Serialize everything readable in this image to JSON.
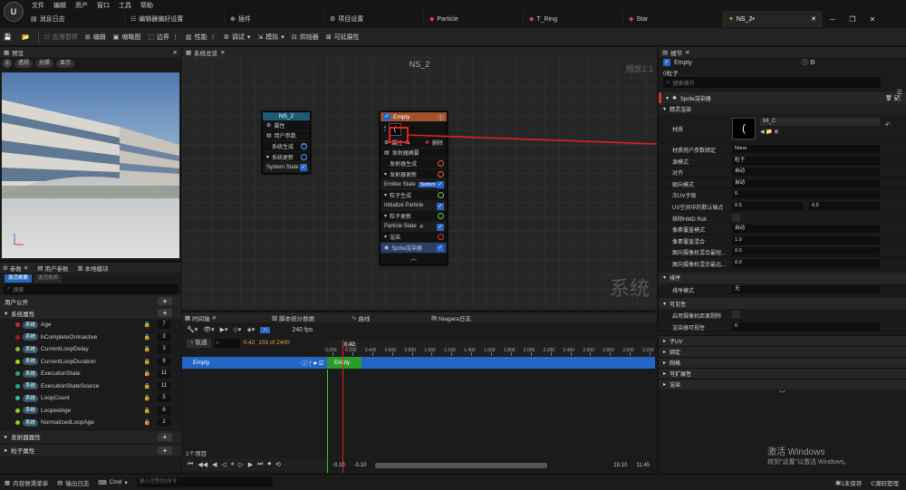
{
  "menubar": {
    "items": [
      "文件",
      "编辑",
      "资产",
      "窗口",
      "工具",
      "帮助"
    ]
  },
  "tabs": [
    {
      "label": "消息日志",
      "icon": "message-log-icon",
      "active": false
    },
    {
      "label": "编辑器偏好设置",
      "icon": "preferences-icon",
      "active": false
    },
    {
      "label": "插件",
      "icon": "plugin-icon",
      "active": false
    },
    {
      "label": "项目设置",
      "icon": "settings-icon",
      "active": false
    },
    {
      "label": "Particle",
      "icon": "particle-icon",
      "active": false
    },
    {
      "label": "T_Ring",
      "icon": "texture-icon",
      "active": false
    },
    {
      "label": "Star",
      "icon": "texture-icon",
      "active": false
    },
    {
      "label": "NS_2•",
      "icon": "niagara-icon",
      "active": true
    }
  ],
  "toolbar": {
    "apply_label": "应用暂停",
    "compile_label": "编辑",
    "thumbnail_label": "缩略图",
    "bounds_label": "边界",
    "perf_label": "性能",
    "debug_label": "调试",
    "simulate_label": "模拟",
    "baker_label": "烘焙器",
    "scalability_label": "可延展性"
  },
  "preview": {
    "tab_label": "预览",
    "perspective_label": "透视",
    "lighting_label": "光照",
    "show_label": "显示"
  },
  "params": {
    "tabs": [
      "参数",
      "用户参数",
      "本地模块"
    ],
    "subtabs": [
      "激活概要",
      "激活视频"
    ],
    "search_placeholder": "搜索",
    "sections": {
      "user": "用户公开",
      "system": "系统属性",
      "emitter": "发射器属性",
      "particle": "粒子属性"
    },
    "rows": [
      {
        "badge": "系统",
        "name": "Age",
        "value": "7",
        "color": "#c52b2b"
      },
      {
        "badge": "系统",
        "name": "bCompleteOnInactive",
        "value": "3",
        "color": "#a11a1a"
      },
      {
        "badge": "系统",
        "name": "CurrentLoopDelay",
        "value": "3",
        "color": "#7dc41c"
      },
      {
        "badge": "系统",
        "name": "CurrentLoopDuration",
        "value": "9",
        "color": "#9fd21a"
      },
      {
        "badge": "系统",
        "name": "ExecutionState",
        "value": "11",
        "color": "#2aa38c"
      },
      {
        "badge": "系统",
        "name": "ExecutionStateSource",
        "value": "11",
        "color": "#2aa38c"
      },
      {
        "badge": "系统",
        "name": "LoopCount",
        "value": "5",
        "color": "#2fbf94"
      },
      {
        "badge": "系统",
        "name": "LoopedAge",
        "value": "6",
        "color": "#83d21c"
      },
      {
        "badge": "系统",
        "name": "NormalizedLoopAge",
        "value": "2",
        "color": "#83d21c"
      }
    ]
  },
  "graph": {
    "tab_label": "系统总览",
    "title": "NS_2",
    "zoom": "缩放1:1",
    "watermark": "系统",
    "system_node": {
      "title": "NS_2",
      "rows": [
        "属性",
        "用户参数",
        "系统生成",
        "系统更新",
        "System State"
      ]
    },
    "emitter_node": {
      "title": "Empty",
      "sprite": "(",
      "rows": [
        "属性",
        "删除",
        "发射器摘要",
        "发射器生成",
        "发射器更新",
        "Emitter State",
        "System",
        "粒子生成",
        "Initialize Particle",
        "粒子更新",
        "Particle State",
        "渲染",
        "Sprite渲染器"
      ]
    }
  },
  "timeline": {
    "tabs": [
      "时间轴",
      "脚本统计数据",
      "曲线",
      "Niagara日志"
    ],
    "fps": "240 fps",
    "add_track": "轨道",
    "current": "0.42",
    "frames": "103 of 2400",
    "track": "Empty",
    "clip": "Empty",
    "playhead": "0.42",
    "ticks": [
      "0.000",
      "0.200",
      "0.400",
      "0.600",
      "0.800",
      "1.000",
      "1.200",
      "1.400",
      "1.600",
      "1.800",
      "2.000",
      "2.200",
      "2.400",
      "2.600",
      "2.800",
      "3.000",
      "3.200"
    ],
    "count_label": "1个项目",
    "range": [
      "-0.10",
      "-0.10",
      "10.10",
      "11.45"
    ]
  },
  "details": {
    "tab_label": "细节",
    "name": "Empty",
    "particles": "0粒子",
    "search_placeholder": "搜索细节",
    "renderer_label": "Sprite渲染器",
    "binding_section": "精灵渲染",
    "material_label": "材质",
    "material_value": "MI_C",
    "rows": [
      {
        "label": "材质用户参数绑定",
        "value": "None"
      },
      {
        "label": "源模式",
        "value": "粒子"
      },
      {
        "label": "对齐",
        "value": "自动"
      },
      {
        "label": "朝向模式",
        "value": "自动"
      },
      {
        "label": "次UV子级",
        "value": "0"
      },
      {
        "label": "UV空间中的默认轴点",
        "value": "0.5",
        "value2": "0.5"
      },
      {
        "label": "移除HMD Roll",
        "value": ""
      },
      {
        "label": "像素覆盖模式",
        "value": "自动"
      },
      {
        "label": "像素覆盖混合",
        "value": "1.0"
      },
      {
        "label": "面向摄像机混合最短...",
        "value": "0.0"
      },
      {
        "label": "面向摄像机混合最远...",
        "value": "0.0"
      }
    ],
    "sort_section": "排序",
    "sort_label": "排序模式",
    "sort_value": "无",
    "vis_section": "可见性",
    "vis_rows": [
      {
        "label": "启用摄像机距离剔除",
        "value": ""
      },
      {
        "label": "渲染器可视性",
        "value": "0"
      }
    ],
    "collapsed": [
      "子UV",
      "绑定",
      "网格",
      "可扩展性",
      "渲染"
    ]
  },
  "activation": {
    "title": "激活 Windows",
    "body": "转到\"设置\"以激活 Windows。"
  },
  "status": {
    "drawer": "内容侧滑菜单",
    "log": "输出日志",
    "cmd": "Cmd",
    "cmd_placeholder": "输入控制台命令",
    "save": "1未保存",
    "source": "C源码管理"
  }
}
